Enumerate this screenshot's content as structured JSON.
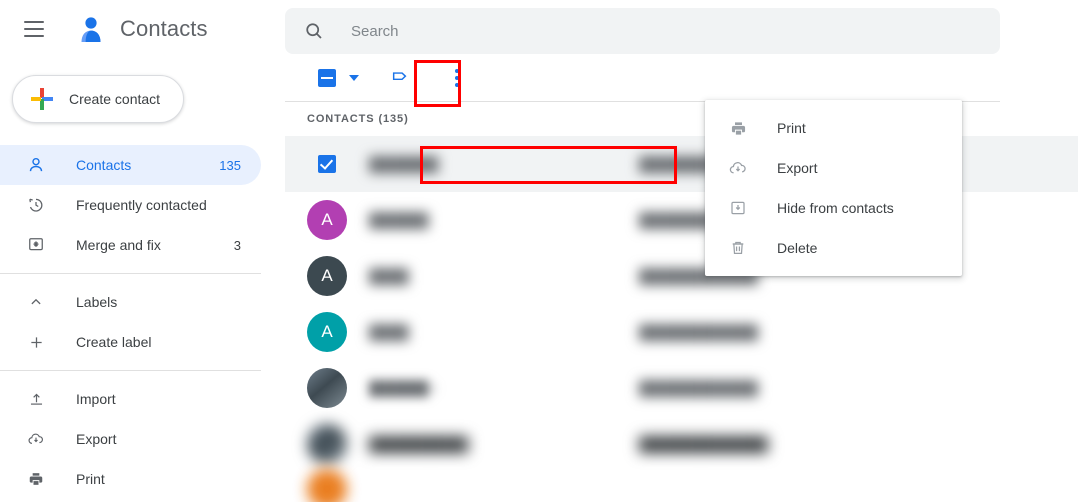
{
  "app": {
    "title": "Contacts",
    "logo_icon": "contacts-person-icon",
    "menu_icon": "hamburger-icon",
    "accent_blue": "#1a73e8",
    "selected_bg": "#e8f0fe",
    "row_selected_bg": "#f1f3f4",
    "highlight_color": "#ff0000"
  },
  "sidebar": {
    "create_contact": {
      "label": "Create contact",
      "icon": "google-plus-icon"
    },
    "groups": [
      {
        "items": [
          {
            "label": "Contacts",
            "count": "135",
            "icon": "person-outline-icon",
            "active": true
          },
          {
            "label": "Frequently contacted",
            "count": "",
            "icon": "history-icon",
            "active": false
          },
          {
            "label": "Merge and fix",
            "count": "3",
            "icon": "merge-fix-icon",
            "active": false
          }
        ]
      },
      {
        "items": [
          {
            "label": "Labels",
            "count": "",
            "icon": "chevron-up-icon",
            "active": false
          },
          {
            "label": "Create label",
            "count": "",
            "icon": "plus-icon",
            "active": false
          }
        ]
      },
      {
        "items": [
          {
            "label": "Import",
            "count": "",
            "icon": "upload-icon",
            "active": false
          },
          {
            "label": "Export",
            "count": "",
            "icon": "cloud-download-icon",
            "active": false
          },
          {
            "label": "Print",
            "count": "",
            "icon": "printer-icon",
            "active": false
          }
        ]
      }
    ]
  },
  "search": {
    "placeholder": "Search",
    "value": "",
    "icon": "search-icon"
  },
  "toolbar": {
    "select_all_checkbox": {
      "state": "indeterminate",
      "icon": "checkbox-indeterminate-icon"
    },
    "select_dropdown": {
      "icon": "caret-down-icon"
    },
    "manage_labels": {
      "icon": "label-tag-icon"
    },
    "more_actions": {
      "icon": "more-vert-icon",
      "highlighted": true
    }
  },
  "list": {
    "header": "CONTACTS (135)",
    "rows": [
      {
        "selected": true,
        "checkbox": "checked",
        "avatar_type": "hidden",
        "avatar_letter": "",
        "avatar_color": "",
        "name": "███████",
        "email": "█████████████"
      },
      {
        "selected": false,
        "checkbox": "unchecked",
        "avatar_type": "letter",
        "avatar_letter": "A",
        "avatar_color": "#b23fb2",
        "name": "██████",
        "email": "██████████████"
      },
      {
        "selected": false,
        "checkbox": "unchecked",
        "avatar_type": "letter",
        "avatar_letter": "A",
        "avatar_color": "#3c4950",
        "name": "████",
        "email": "████████████"
      },
      {
        "selected": false,
        "checkbox": "unchecked",
        "avatar_type": "letter",
        "avatar_letter": "A",
        "avatar_color": "#00a0a8",
        "name": "████",
        "email": "████████████"
      },
      {
        "selected": false,
        "checkbox": "unchecked",
        "avatar_type": "photo",
        "avatar_letter": "",
        "avatar_color": "",
        "name": "██████ i",
        "email": "████████████"
      },
      {
        "selected": false,
        "checkbox": "unchecked",
        "avatar_type": "photo",
        "avatar_letter": "",
        "avatar_color": "",
        "name": "██████████",
        "email": "█████████████"
      }
    ],
    "peek_row": {
      "avatar_color": "#e8710a"
    }
  },
  "menu": {
    "items": [
      {
        "label": "Print",
        "icon": "printer-icon",
        "highlighted": false
      },
      {
        "label": "Export",
        "icon": "cloud-download-icon",
        "highlighted": true
      },
      {
        "label": "Hide from contacts",
        "icon": "hide-contacts-icon",
        "highlighted": false
      },
      {
        "label": "Delete",
        "icon": "trash-icon",
        "highlighted": false
      }
    ]
  }
}
